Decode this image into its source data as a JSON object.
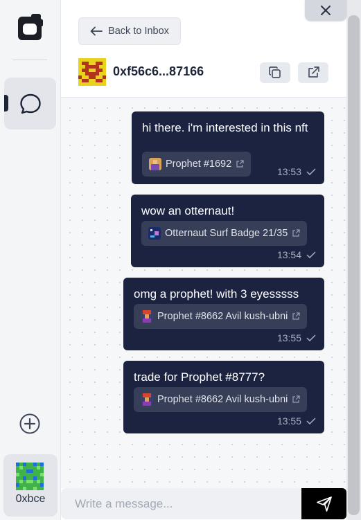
{
  "rail": {
    "account_label": "0xbce"
  },
  "header": {
    "back_label": "Back to Inbox",
    "peer_address": "0xf56c6...87166"
  },
  "messages": [
    {
      "text": "hi there. i'm interested in this nft",
      "nft": "Prophet #1692",
      "time": "13:53"
    },
    {
      "text": "wow an otternaut!",
      "nft": "Otternaut Surf Badge 21/35",
      "time": "13:54"
    },
    {
      "text": "omg a prophet! with 3 eyesssss",
      "nft": "Prophet #8662 Avil kush-ubni",
      "time": "13:55"
    },
    {
      "text": "trade for Prophet #8777?",
      "nft": "Prophet #8662 Avil kush-ubni",
      "time": "13:55"
    }
  ],
  "composer": {
    "placeholder": "Write a message..."
  },
  "colors": {
    "bubble": "#1b2340",
    "chip": "#363e58",
    "send": "#000000"
  }
}
